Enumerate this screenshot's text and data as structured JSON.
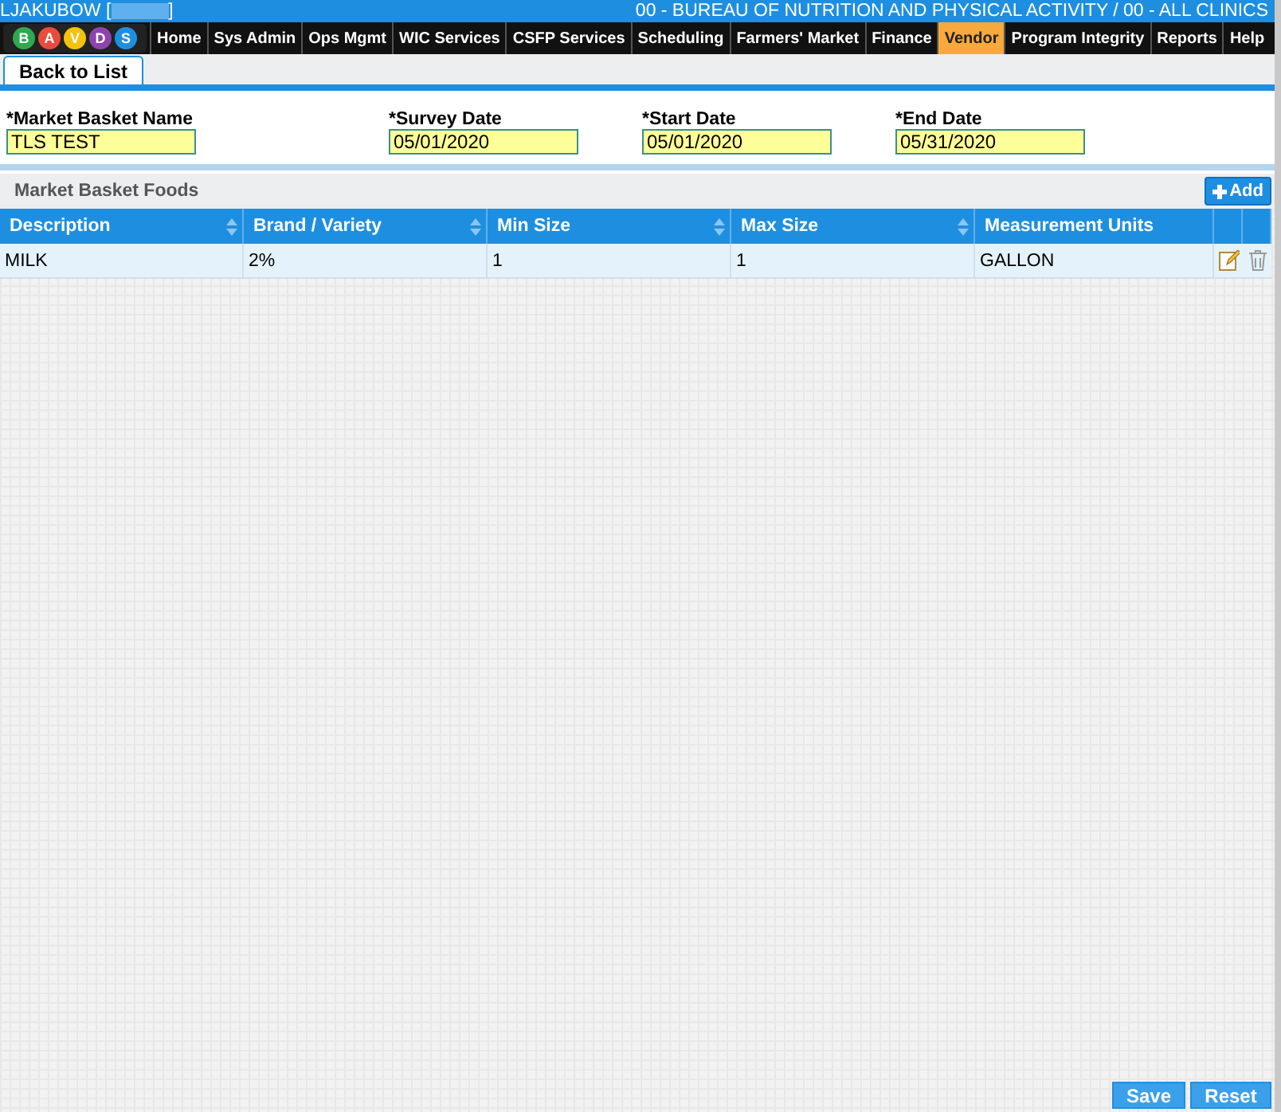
{
  "header": {
    "user_prefix": "LJAKUBOW [",
    "user_suffix": "]",
    "organization": "00 - BUREAU OF NUTRITION AND PHYSICAL ACTIVITY / 00 - ALL CLINICS"
  },
  "logo": {
    "letters": [
      "B",
      "A",
      "V",
      "D",
      "S"
    ]
  },
  "nav": [
    {
      "label": "Home",
      "selected": false
    },
    {
      "label": "Sys Admin",
      "selected": false
    },
    {
      "label": "Ops Mgmt",
      "selected": false
    },
    {
      "label": "WIC Services",
      "selected": false
    },
    {
      "label": "CSFP Services",
      "selected": false
    },
    {
      "label": "Scheduling",
      "selected": false
    },
    {
      "label": "Farmers' Market",
      "selected": false
    },
    {
      "label": "Finance",
      "selected": false
    },
    {
      "label": "Vendor",
      "selected": true
    },
    {
      "label": "Program Integrity",
      "selected": false
    },
    {
      "label": "Reports",
      "selected": false
    },
    {
      "label": "Help",
      "selected": false
    }
  ],
  "back_button": "Back to List",
  "fields": [
    {
      "label": "*Market Basket Name",
      "value": "TLS TEST"
    },
    {
      "label": "*Survey Date",
      "value": "05/01/2020"
    },
    {
      "label": "*Start Date",
      "value": "05/01/2020"
    },
    {
      "label": "*End Date",
      "value": "05/31/2020"
    }
  ],
  "section": {
    "title": "Market Basket Foods",
    "add_button": "Add"
  },
  "table": {
    "columns": [
      {
        "label": "Description",
        "sortable": true
      },
      {
        "label": "Brand / Variety",
        "sortable": true
      },
      {
        "label": "Min Size",
        "sortable": true
      },
      {
        "label": "Max Size",
        "sortable": true
      },
      {
        "label": "Measurement Units",
        "sortable": false
      }
    ],
    "rows": [
      {
        "cells": [
          "MILK",
          "2%",
          "1",
          "1",
          "GALLON"
        ]
      }
    ]
  },
  "footer_buttons": [
    "Save",
    "Reset"
  ]
}
